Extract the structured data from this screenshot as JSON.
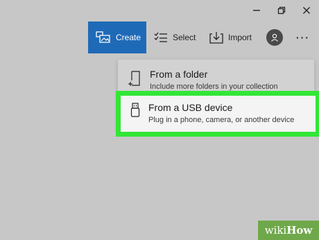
{
  "window_controls": {
    "icons": [
      "minimize-icon",
      "restore-icon",
      "close-icon"
    ]
  },
  "toolbar": {
    "create_label": "Create",
    "select_label": "Select",
    "import_label": "Import",
    "more_label": "···"
  },
  "import_menu": {
    "items": [
      {
        "title": "From a folder",
        "subtitle": "Include more folders in your collection",
        "icon": "folder-add-icon"
      },
      {
        "title": "From a USB device",
        "subtitle": "Plug in a phone, camera, or another device",
        "icon": "usb-icon"
      }
    ]
  },
  "watermark": {
    "part1": "wiki",
    "part2": "How"
  },
  "colors": {
    "background": "#c7c7c7",
    "create_button": "#1f6ab7",
    "highlight_border": "#32e636",
    "watermark_bg": "#6fa84a"
  }
}
